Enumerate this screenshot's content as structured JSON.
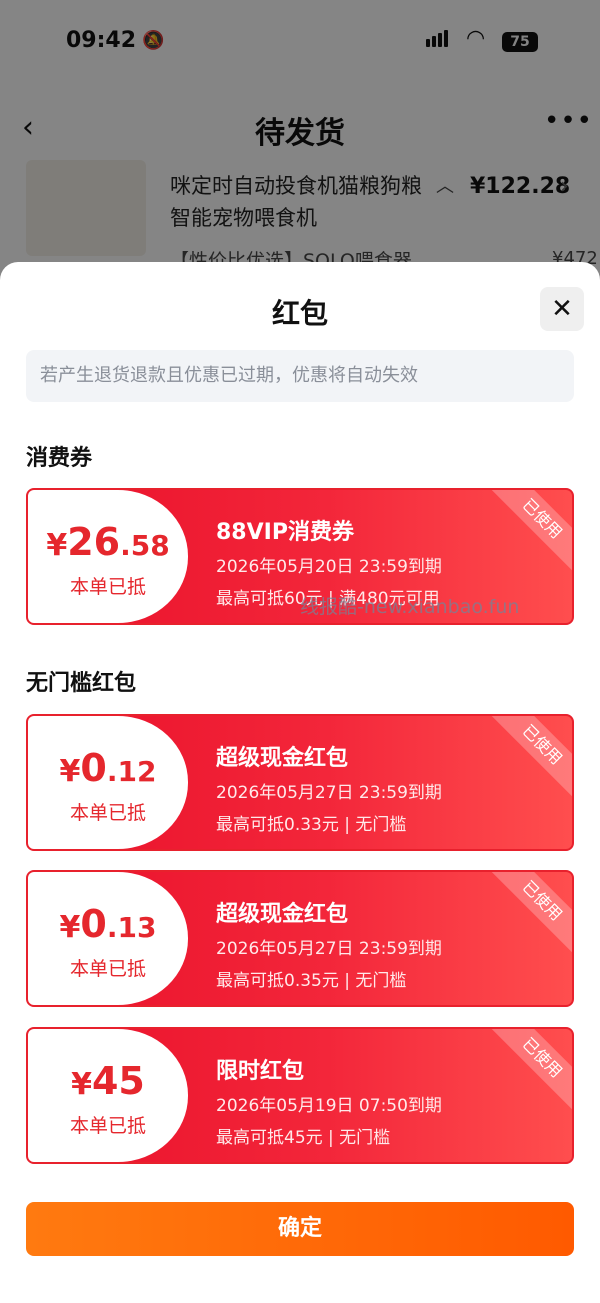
{
  "status_bar": {
    "time": "09:42",
    "battery": "75"
  },
  "nav": {
    "back": "‹",
    "title": "待发货",
    "more": "•••"
  },
  "product": {
    "name": "咪定时自动投食机猫粮狗粮智能宠物喂食机",
    "price": "¥122.28",
    "name2": "【性价比优选】SOLO喂食器",
    "price2": "¥472"
  },
  "sheet": {
    "title": "红包",
    "close": "✕",
    "notice": "若产生退货退款且优惠已过期，优惠将自动失效",
    "sections": {
      "consumer": "消费券",
      "no_threshold": "无门槛红包"
    },
    "confirm": "确定"
  },
  "coupons": [
    {
      "yen": "¥",
      "amount_int": "26",
      "amount_dec": ".58",
      "used_on": "本单已抵",
      "title": "88VIP消费券",
      "expire": "2026年05月20日  23:59到期",
      "rule": "最高可抵60元 | 满480元可用",
      "stamp": "已使用"
    },
    {
      "yen": "¥",
      "amount_int": "0",
      "amount_dec": ".12",
      "used_on": "本单已抵",
      "title": "超级现金红包",
      "expire": "2026年05月27日  23:59到期",
      "rule": "最高可抵0.33元 | 无门槛",
      "stamp": "已使用"
    },
    {
      "yen": "¥",
      "amount_int": "0",
      "amount_dec": ".13",
      "used_on": "本单已抵",
      "title": "超级现金红包",
      "expire": "2026年05月27日  23:59到期",
      "rule": "最高可抵0.35元 | 无门槛",
      "stamp": "已使用"
    },
    {
      "yen": "¥",
      "amount_int": "45",
      "amount_dec": "",
      "used_on": "本单已抵",
      "title": "限时红包",
      "expire": "2026年05月19日  07:50到期",
      "rule": "最高可抵45元 | 无门槛",
      "stamp": "已使用"
    }
  ],
  "watermark": "线报酷-new.xianbao.fun",
  "colors": {
    "accent_red": "#e5272d",
    "confirm_orange": "#ff6a00"
  }
}
